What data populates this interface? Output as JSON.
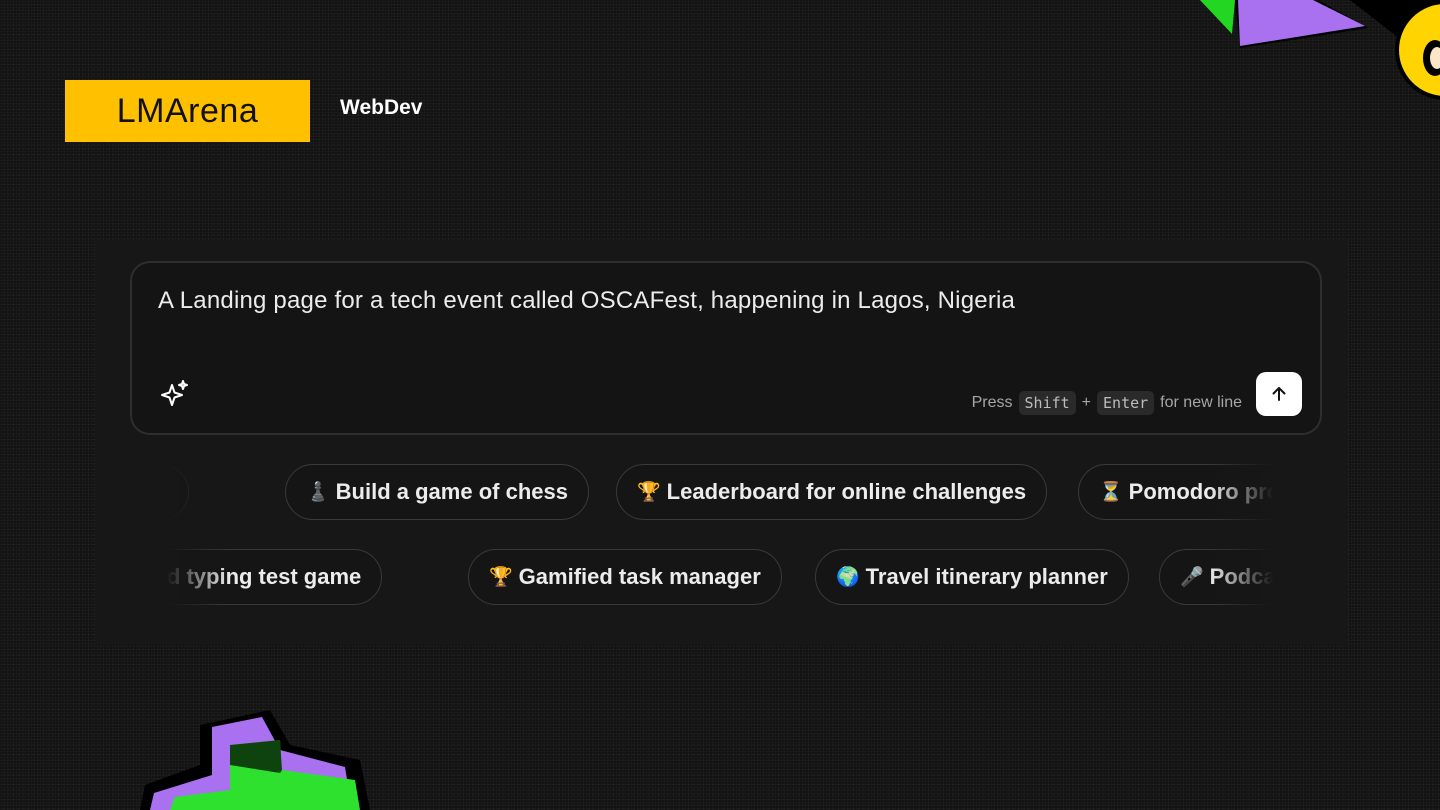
{
  "brand": {
    "logo_text": "LMArena",
    "accent": "#ffc000"
  },
  "nav": {
    "webdev_label": "WebDev"
  },
  "prompt": {
    "value": "A Landing page for a tech event called OSCAFest, happening in Lagos, Nigeria",
    "hint_press": "Press",
    "hint_key1": "Shift",
    "hint_plus": "+",
    "hint_key2": "Enter",
    "hint_suffix": "for new line",
    "enhance_icon": "sparkle-icon",
    "send_icon": "arrow-up-icon"
  },
  "suggestions": {
    "row1": [
      {
        "emoji": "",
        "label": "game"
      },
      {
        "emoji": "♟️",
        "label": "Build a game of chess"
      },
      {
        "emoji": "🏆",
        "label": "Leaderboard for online challenges"
      },
      {
        "emoji": "⏳",
        "label": "Pomodoro pro"
      }
    ],
    "row2": [
      {
        "emoji": "",
        "label": "peed typing test game"
      },
      {
        "emoji": "🏆",
        "label": "Gamified task manager"
      },
      {
        "emoji": "🌍",
        "label": "Travel itinerary planner"
      },
      {
        "emoji": "🎤",
        "label": "Podca"
      }
    ]
  }
}
